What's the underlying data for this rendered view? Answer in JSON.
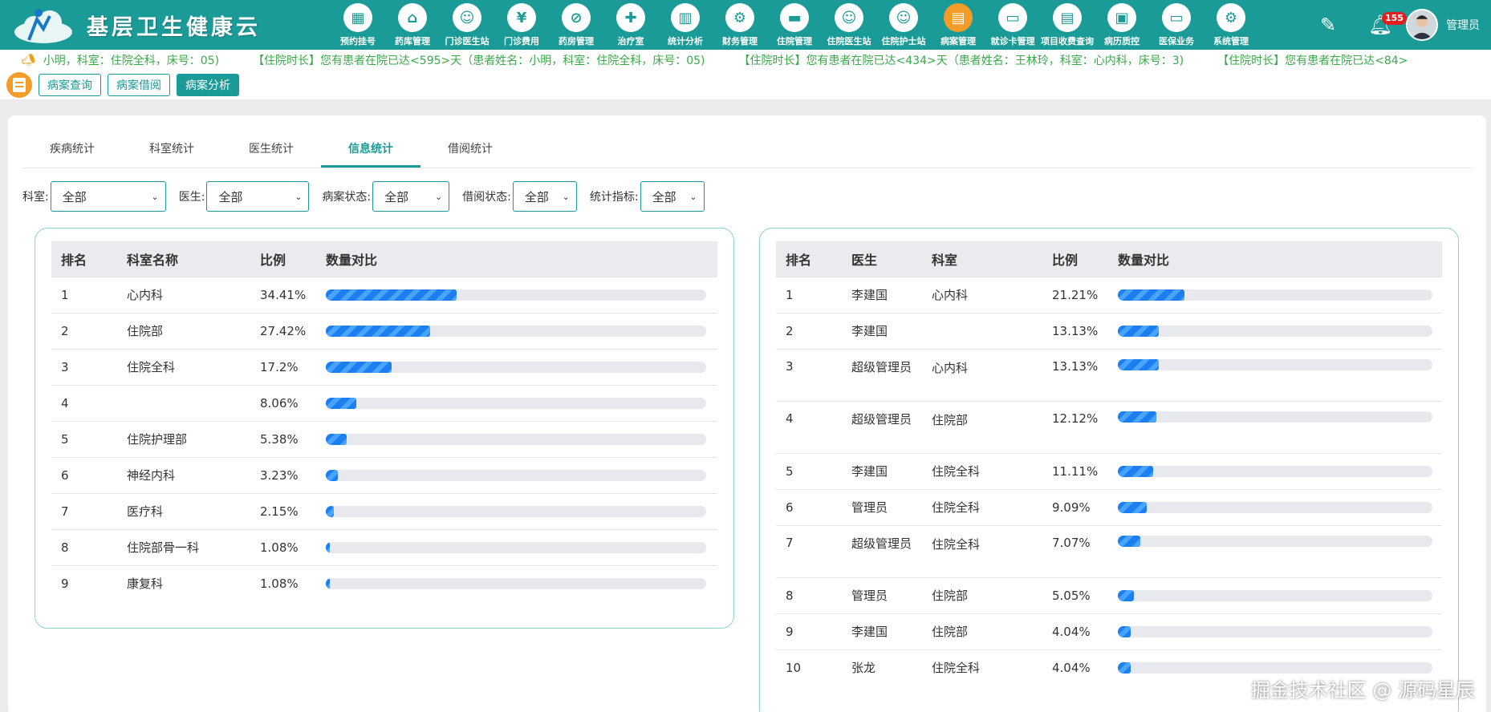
{
  "app": {
    "title": "基层卫生健康云",
    "user": "管理员",
    "notification_count": "155"
  },
  "nav": [
    {
      "label": "预约挂号",
      "icon": "calendar-icon",
      "glyph": "▦"
    },
    {
      "label": "药库管理",
      "icon": "warehouse-icon",
      "glyph": "⌂"
    },
    {
      "label": "门诊医生站",
      "icon": "doctor-icon",
      "glyph": "☺"
    },
    {
      "label": "门诊费用",
      "icon": "yen-icon",
      "glyph": "¥"
    },
    {
      "label": "药房管理",
      "icon": "pill-icon",
      "glyph": "⊘"
    },
    {
      "label": "治疗室",
      "icon": "nurse-icon",
      "glyph": "✚"
    },
    {
      "label": "统计分析",
      "icon": "chart-icon",
      "glyph": "▥"
    },
    {
      "label": "财务管理",
      "icon": "finance-gear-icon",
      "glyph": "⚙"
    },
    {
      "label": "住院管理",
      "icon": "bed-icon",
      "glyph": "▬"
    },
    {
      "label": "住院医生站",
      "icon": "inpatient-doctor-icon",
      "glyph": "☺"
    },
    {
      "label": "住院护士站",
      "icon": "inpatient-nurse-icon",
      "glyph": "☺"
    },
    {
      "label": "病案管理",
      "icon": "record-icon",
      "glyph": "▤"
    },
    {
      "label": "就诊卡管理",
      "icon": "card-icon",
      "glyph": "▭"
    },
    {
      "label": "项目收费查询",
      "icon": "billing-icon",
      "glyph": "▤"
    },
    {
      "label": "病历质控",
      "icon": "quality-icon",
      "glyph": "▣"
    },
    {
      "label": "医保业务",
      "icon": "insurance-icon",
      "glyph": "▭"
    },
    {
      "label": "系统管理",
      "icon": "system-gear-icon",
      "glyph": "⚙"
    }
  ],
  "marquee": [
    "小明，科室：住院全科，床号：05)",
    "【住院时长】您有患者在院已达<595>天（患者姓名：小明，科室：住院全科，床号：05)",
    "【住院时长】您有患者在院已达<434>天（患者姓名：王林玲，科室：心内科，床号：3)",
    "【住院时长】您有患者在院已达<84>"
  ],
  "subnav": {
    "query": "病案查询",
    "borrow": "病案借阅",
    "analysis": "病案分析"
  },
  "tabs": [
    "疾病统计",
    "科室统计",
    "医生统计",
    "信息统计",
    "借阅统计"
  ],
  "filters": {
    "dept": {
      "label": "科室:",
      "value": "全部"
    },
    "doctor": {
      "label": "医生:",
      "value": "全部"
    },
    "case_status": {
      "label": "病案状态:",
      "value": "全部"
    },
    "borrow_status": {
      "label": "借阅状态:",
      "value": "全部"
    },
    "metric": {
      "label": "统计指标:",
      "value": "全部"
    }
  },
  "left_table": {
    "headers": [
      "排名",
      "科室名称",
      "比例",
      "数量对比"
    ],
    "rows": [
      {
        "rank": "1",
        "dept": "心内科",
        "ratio": "34.41%",
        "pct": 34.41
      },
      {
        "rank": "2",
        "dept": "住院部",
        "ratio": "27.42%",
        "pct": 27.42
      },
      {
        "rank": "3",
        "dept": "住院全科",
        "ratio": "17.2%",
        "pct": 17.2
      },
      {
        "rank": "4",
        "dept": "",
        "ratio": "8.06%",
        "pct": 8.06
      },
      {
        "rank": "5",
        "dept": "住院护理部",
        "ratio": "5.38%",
        "pct": 5.38
      },
      {
        "rank": "6",
        "dept": "神经内科",
        "ratio": "3.23%",
        "pct": 3.23
      },
      {
        "rank": "7",
        "dept": "医疗科",
        "ratio": "2.15%",
        "pct": 2.15
      },
      {
        "rank": "8",
        "dept": "住院部骨一科",
        "ratio": "1.08%",
        "pct": 1.08
      },
      {
        "rank": "9",
        "dept": "康复科",
        "ratio": "1.08%",
        "pct": 1.08
      }
    ]
  },
  "right_table": {
    "headers": [
      "排名",
      "医生",
      "科室",
      "比例",
      "数量对比"
    ],
    "rows": [
      {
        "rank": "1",
        "doctor": "李建国",
        "dept": "心内科",
        "ratio": "21.21%",
        "pct": 21.21
      },
      {
        "rank": "2",
        "doctor": "李建国",
        "dept": "",
        "ratio": "13.13%",
        "pct": 13.13
      },
      {
        "rank": "3",
        "doctor": "超级管理员",
        "dept": "心内科",
        "ratio": "13.13%",
        "pct": 13.13
      },
      {
        "rank": "4",
        "doctor": "超级管理员",
        "dept": "住院部",
        "ratio": "12.12%",
        "pct": 12.12
      },
      {
        "rank": "5",
        "doctor": "李建国",
        "dept": "住院全科",
        "ratio": "11.11%",
        "pct": 11.11
      },
      {
        "rank": "6",
        "doctor": "管理员",
        "dept": "住院全科",
        "ratio": "9.09%",
        "pct": 9.09
      },
      {
        "rank": "7",
        "doctor": "超级管理员",
        "dept": "住院全科",
        "ratio": "7.07%",
        "pct": 7.07
      },
      {
        "rank": "8",
        "doctor": "管理员",
        "dept": "住院部",
        "ratio": "5.05%",
        "pct": 5.05
      },
      {
        "rank": "9",
        "doctor": "李建国",
        "dept": "住院部",
        "ratio": "4.04%",
        "pct": 4.04
      },
      {
        "rank": "10",
        "doctor": "张龙",
        "dept": "住院全科",
        "ratio": "4.04%",
        "pct": 4.04
      }
    ]
  },
  "watermark": "掘金技术社区 @ 源码星辰",
  "colors": {
    "primary": "#1a9b97",
    "active_orange": "#f39c27",
    "bar": "#1b7ff0"
  }
}
